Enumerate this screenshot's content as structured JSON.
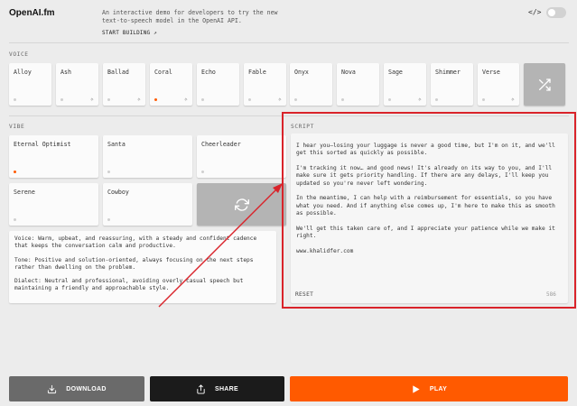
{
  "header": {
    "logo": "OpenAI.fm",
    "intro": "An interactive demo for developers to try the new text-to-speech model in the OpenAI API.",
    "start_building": "START BUILDING ↗",
    "code_icon_text": "</>"
  },
  "voice": {
    "label": "VOICE",
    "items": [
      {
        "label": "Alloy",
        "icon": "dot"
      },
      {
        "label": "Ash",
        "icon": "sparkle"
      },
      {
        "label": "Ballad",
        "icon": "sparkle"
      },
      {
        "label": "Coral",
        "icon": "dot-and-sparkle-active"
      },
      {
        "label": "Echo",
        "icon": "dot"
      },
      {
        "label": "Fable",
        "icon": "sparkle"
      },
      {
        "label": "Onyx",
        "icon": "dot"
      },
      {
        "label": "Nova",
        "icon": "dot"
      },
      {
        "label": "Sage",
        "icon": "sparkle"
      },
      {
        "label": "Shimmer",
        "icon": "dot"
      },
      {
        "label": "Verse",
        "icon": "sparkle"
      }
    ],
    "shuffle_icon": "shuffle-icon"
  },
  "vibe": {
    "label": "VIBE",
    "items": [
      {
        "label": "Eternal Optimist",
        "active": true
      },
      {
        "label": "Santa",
        "active": false
      },
      {
        "label": "Cheerleader",
        "active": false
      },
      {
        "label": "Serene",
        "active": false
      },
      {
        "label": "Cowboy",
        "active": false
      }
    ],
    "refresh_icon": "refresh-icon",
    "description": [
      "Voice: Warm, upbeat, and reassuring, with a steady and confident cadence that keeps the conversation calm and productive.",
      "Tone: Positive and solution-oriented, always focusing on the next steps rather than dwelling on the problem.",
      "Dialect: Neutral and professional, avoiding overly casual speech but maintaining a friendly and approachable style."
    ]
  },
  "script": {
    "label": "SCRIPT",
    "paragraphs": [
      "I hear you—losing your luggage is never a good time, but I'm on it, and we'll get this sorted as quickly as possible.",
      "I'm tracking it now… and good news! It's already on its way to you, and I'll make sure it gets priority handling. If there are any delays, I'll keep you updated so you're never left wondering.",
      "In the meantime, I can help with a reimbursement for essentials, so you have what you need. And if anything else comes up, I'm here to make this as smooth as possible.",
      "We'll get this taken care of, and I appreciate your patience while we make it right.",
      "www.khalidfer.com"
    ],
    "reset_label": "RESET",
    "char_count": "586"
  },
  "footer": {
    "download_label": "DOWNLOAD",
    "share_label": "SHARE",
    "play_label": "PLAY"
  },
  "colors": {
    "accent": "#ff5a00",
    "annotation": "#d9232a"
  }
}
